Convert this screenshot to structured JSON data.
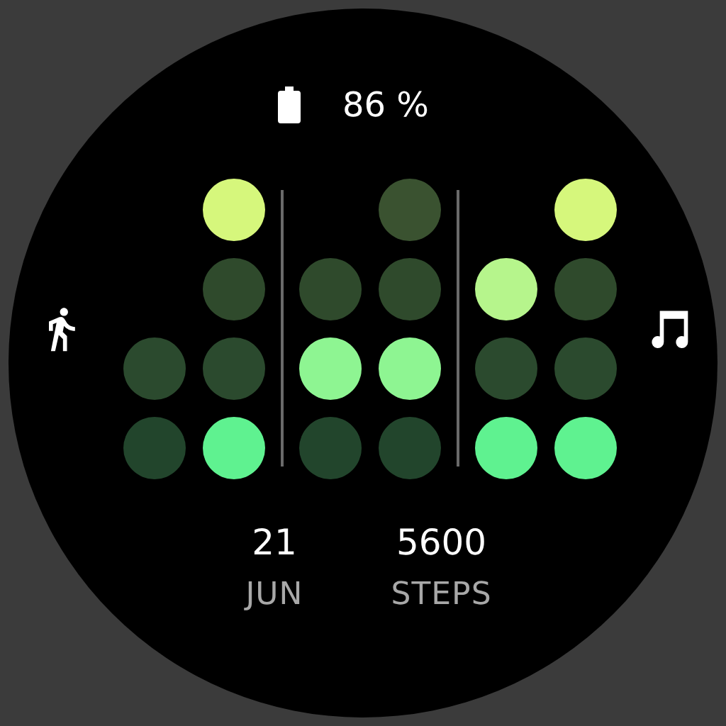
{
  "battery": {
    "reading": "86 %"
  },
  "dot_groups": [
    {
      "columns": [
        {
          "dots": [
            {
              "on": false
            },
            {
              "on": false
            }
          ]
        },
        {
          "dots": [
            {
              "on": true
            },
            {
              "on": false
            },
            {
              "on": false
            },
            {
              "on": true
            }
          ]
        }
      ]
    },
    {
      "columns": [
        {
          "dots": [
            {
              "on": false
            },
            {
              "on": true
            },
            {
              "on": false
            }
          ]
        },
        {
          "dots": [
            {
              "on": false
            },
            {
              "on": false
            },
            {
              "on": true
            },
            {
              "on": false
            }
          ]
        }
      ]
    },
    {
      "columns": [
        {
          "dots": [
            {
              "on": true
            },
            {
              "on": false
            },
            {
              "on": true
            }
          ]
        },
        {
          "dots": [
            {
              "on": true
            },
            {
              "on": false
            },
            {
              "on": false
            },
            {
              "on": true
            }
          ]
        }
      ]
    }
  ],
  "stats": [
    {
      "value": "21",
      "label": "JUN"
    },
    {
      "value": "5600",
      "label": "STEPS"
    }
  ]
}
